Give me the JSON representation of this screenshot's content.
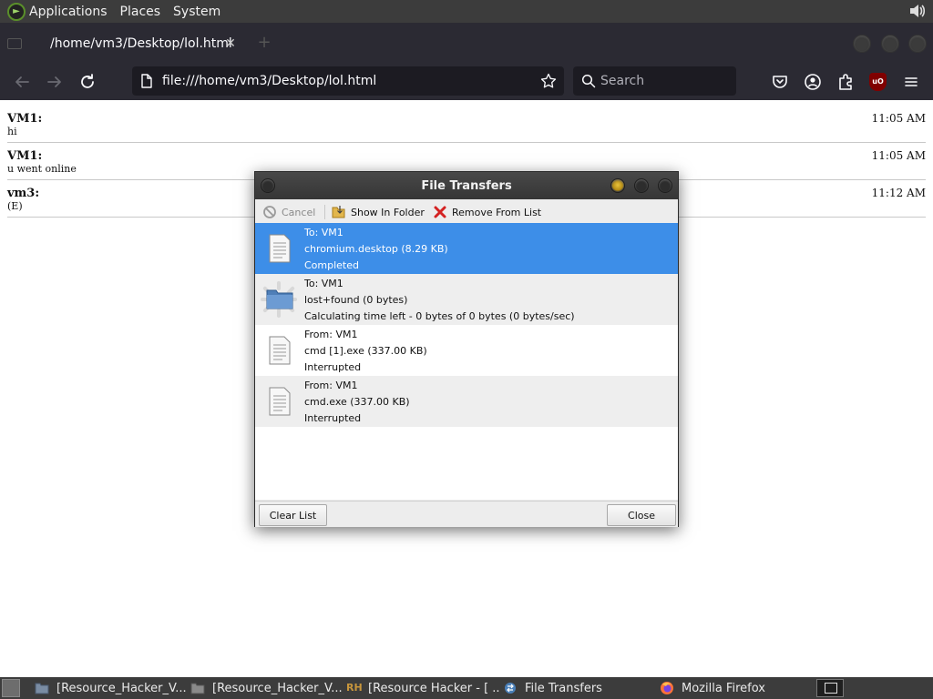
{
  "top_panel": {
    "menus": [
      "Applications",
      "Places",
      "System"
    ]
  },
  "browser": {
    "tab_title": "/home/vm3/Desktop/lol.html",
    "url": "file:///home/vm3/Desktop/lol.html",
    "search_placeholder": "Search",
    "ublock_badge": "uO"
  },
  "chat": {
    "messages": [
      {
        "sender": "VM1:",
        "text": "hi",
        "time": "11:05 AM"
      },
      {
        "sender": "VM1:",
        "text": "u went online",
        "time": "11:05 AM"
      },
      {
        "sender": "vm3:",
        "text": "(E)",
        "time": "11:12 AM"
      }
    ]
  },
  "dialog": {
    "title": "File Transfers",
    "toolbar": {
      "cancel": "Cancel",
      "show_in_folder": "Show In Folder",
      "remove_from_list": "Remove From List"
    },
    "transfers": [
      {
        "direction": "To: VM1",
        "file": "chromium.desktop (8.29 KB)",
        "status": "Completed",
        "icon": "document-icon"
      },
      {
        "direction": "To: VM1",
        "file": "lost+found (0 bytes)",
        "status": "Calculating time left - 0 bytes of 0 bytes (0 bytes/sec)",
        "icon": "folder-icon"
      },
      {
        "direction": "From: VM1",
        "file": "cmd [1].exe (337.00 KB)",
        "status": "Interrupted",
        "icon": "document-icon"
      },
      {
        "direction": "From: VM1",
        "file": "cmd.exe (337.00 KB)",
        "status": "Interrupted",
        "icon": "document-icon"
      }
    ],
    "clear_list": "Clear List",
    "close": "Close"
  },
  "taskbar": {
    "tasks": [
      {
        "label": "[Resource_Hacker_V...",
        "icon": "folder-icon"
      },
      {
        "label": "[Resource_Hacker_V...",
        "icon": "folder-icon"
      },
      {
        "label": "[Resource Hacker - [ ...",
        "icon": "resource-hacker-icon"
      },
      {
        "label": "File Transfers",
        "icon": "transfers-icon"
      },
      {
        "label": "Mozilla Firefox",
        "icon": "firefox-icon"
      }
    ]
  },
  "colors": {
    "panel_bg": "#3c3c3c",
    "firefox_chrome": "#2b2a33",
    "urlbar_bg": "#1c1b22",
    "selection": "#3d8ee8"
  }
}
